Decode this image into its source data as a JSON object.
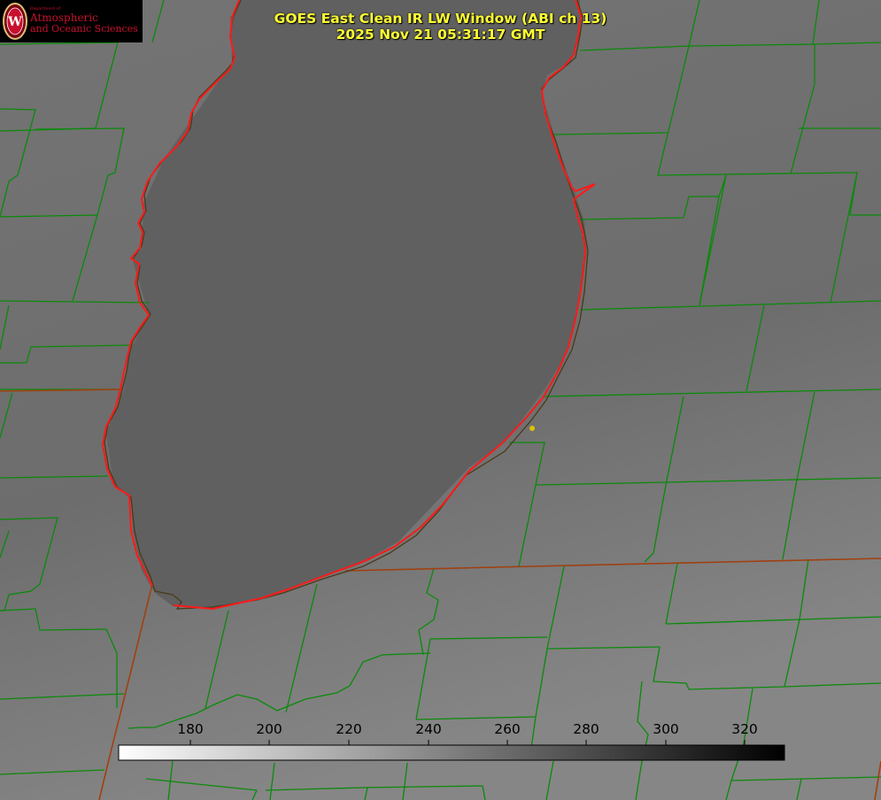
{
  "header": {
    "title": "GOES East Clean IR LW Window (ABI ch 13)",
    "timestamp": "2025 Nov 21 05:31:17 GMT"
  },
  "logo": {
    "dept_small": "Department of",
    "line1": "Atmospheric",
    "line2": "and Oceanic Sciences",
    "color": "#c8102e"
  },
  "colorbar": {
    "ticks": [
      "180",
      "200",
      "220",
      "240",
      "260",
      "280",
      "300",
      "320"
    ],
    "gradient_from": "#ffffff",
    "gradient_to": "#000000"
  },
  "map_colors": {
    "county_lines": "#0a8a0a",
    "state_lines": "#a04010",
    "lake_outline": "#ff1a1a",
    "site_marker": "#e0c000"
  }
}
